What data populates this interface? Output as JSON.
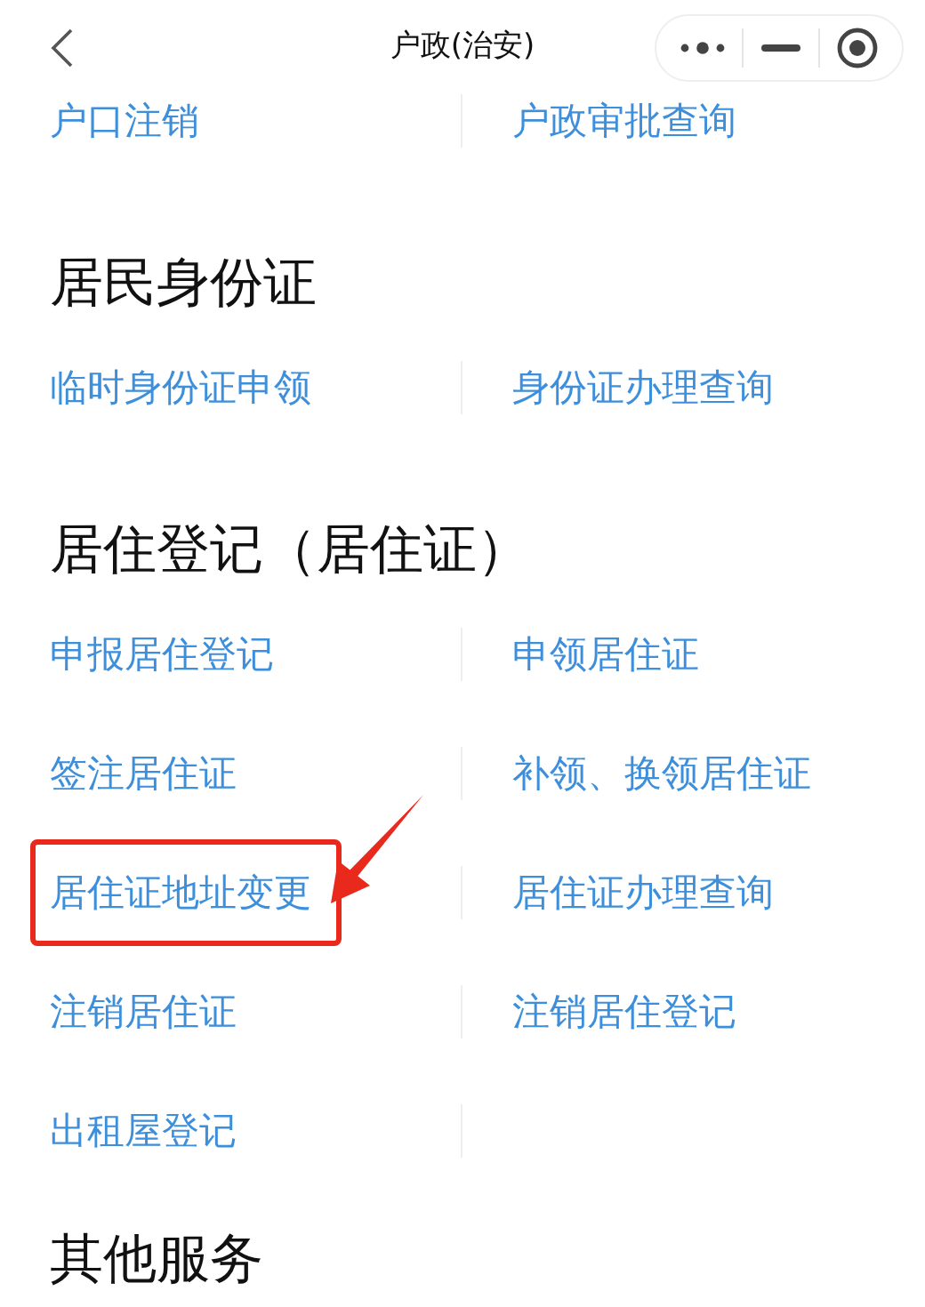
{
  "nav_bar": {
    "title": "户政(治安)"
  },
  "sections": [
    {
      "items": [
        {
          "label": "户口注销",
          "highlighted": false
        },
        {
          "label": "户政审批查询",
          "highlighted": false
        }
      ]
    },
    {
      "title": "居民身份证",
      "items": [
        {
          "label": "临时身份证申领",
          "highlighted": false
        },
        {
          "label": "身份证办理查询",
          "highlighted": false
        }
      ]
    },
    {
      "title": "居住登记（居住证）",
      "items": [
        {
          "label": "申报居住登记",
          "highlighted": false
        },
        {
          "label": "申领居住证",
          "highlighted": false
        },
        {
          "label": "签注居住证",
          "highlighted": false
        },
        {
          "label": "补领、换领居住证",
          "highlighted": false
        },
        {
          "label": "居住证地址变更",
          "highlighted": true
        },
        {
          "label": "居住证办理查询",
          "highlighted": false
        },
        {
          "label": "注销居住证",
          "highlighted": false
        },
        {
          "label": "注销居住登记",
          "highlighted": false
        },
        {
          "label": "出租屋登记",
          "highlighted": false
        }
      ]
    },
    {
      "title": "其他服务"
    }
  ]
}
